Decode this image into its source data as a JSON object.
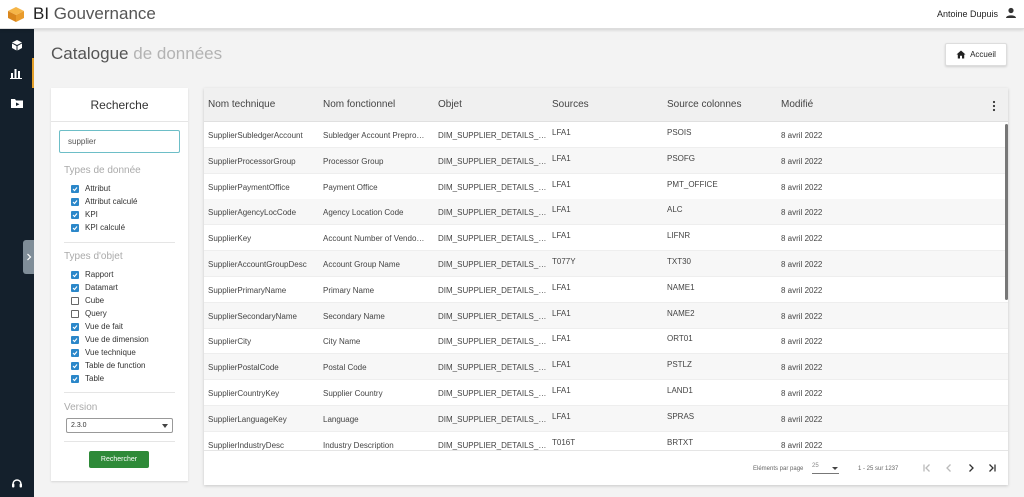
{
  "app": {
    "brand_prefix": "BI",
    "brand_name": "Gouvernance",
    "user_name": "Antoine Dupuis",
    "accent_color": "#e3a02b"
  },
  "nav": {
    "items": [
      "box-icon",
      "bar-chart-icon",
      "folder-video-icon"
    ],
    "bottom": "support-icon"
  },
  "page": {
    "title_main": "Catalogue",
    "title_light": "de données",
    "home_label": "Accueil"
  },
  "search": {
    "header": "Recherche",
    "query": "supplier",
    "data_types_title": "Types de donnée",
    "data_types": [
      {
        "label": "Attribut",
        "checked": true
      },
      {
        "label": "Attribut calculé",
        "checked": true
      },
      {
        "label": "KPI",
        "checked": true
      },
      {
        "label": "KPI calculé",
        "checked": true
      }
    ],
    "object_types_title": "Types d'objet",
    "object_types": [
      {
        "label": "Rapport",
        "checked": true
      },
      {
        "label": "Datamart",
        "checked": true
      },
      {
        "label": "Cube",
        "checked": false
      },
      {
        "label": "Query",
        "checked": false
      },
      {
        "label": "Vue de fait",
        "checked": true
      },
      {
        "label": "Vue de dimension",
        "checked": true
      },
      {
        "label": "Vue technique",
        "checked": true
      },
      {
        "label": "Table de function",
        "checked": true
      },
      {
        "label": "Table",
        "checked": true
      }
    ],
    "version_title": "Version",
    "version_value": "2.3.0",
    "button": "Rechercher",
    "button_color": "#2e8a38"
  },
  "table": {
    "columns": [
      "Nom technique",
      "Nom fonctionnel",
      "Objet",
      "Sources",
      "Source colonnes",
      "Modifié"
    ],
    "rows": [
      [
        "SupplierSubledgerAccount",
        "Subledger Account Prepro…",
        "DIM_SUPPLIER_DETAILS_…",
        "LFA1",
        "PSOIS",
        "8 avril 2022"
      ],
      [
        "SupplierProcessorGroup",
        "Processor Group",
        "DIM_SUPPLIER_DETAILS_…",
        "LFA1",
        "PSOFG",
        "8 avril 2022"
      ],
      [
        "SupplierPaymentOffice",
        "Payment Office",
        "DIM_SUPPLIER_DETAILS_…",
        "LFA1",
        "PMT_OFFICE",
        "8 avril 2022"
      ],
      [
        "SupplierAgencyLocCode",
        "Agency Location Code",
        "DIM_SUPPLIER_DETAILS_…",
        "LFA1",
        "ALC",
        "8 avril 2022"
      ],
      [
        "SupplierKey",
        "Account Number of Vendo…",
        "DIM_SUPPLIER_DETAILS_…",
        "LFA1",
        "LIFNR",
        "8 avril 2022"
      ],
      [
        "SupplierAccountGroupDesc",
        "Account Group Name",
        "DIM_SUPPLIER_DETAILS_…",
        "T077Y",
        "TXT30",
        "8 avril 2022"
      ],
      [
        "SupplierPrimaryName",
        "Primary Name",
        "DIM_SUPPLIER_DETAILS_…",
        "LFA1",
        "NAME1",
        "8 avril 2022"
      ],
      [
        "SupplierSecondaryName",
        "Secondary Name",
        "DIM_SUPPLIER_DETAILS_…",
        "LFA1",
        "NAME2",
        "8 avril 2022"
      ],
      [
        "SupplierCity",
        "City Name",
        "DIM_SUPPLIER_DETAILS_…",
        "LFA1",
        "ORT01",
        "8 avril 2022"
      ],
      [
        "SupplierPostalCode",
        "Postal Code",
        "DIM_SUPPLIER_DETAILS_…",
        "LFA1",
        "PSTLZ",
        "8 avril 2022"
      ],
      [
        "SupplierCountryKey",
        "Supplier Country",
        "DIM_SUPPLIER_DETAILS_…",
        "LFA1",
        "LAND1",
        "8 avril 2022"
      ],
      [
        "SupplierLanguageKey",
        "Language",
        "DIM_SUPPLIER_DETAILS_…",
        "LFA1",
        "SPRAS",
        "8 avril 2022"
      ],
      [
        "SupplierIndustryDesc",
        "Industry Description",
        "DIM_SUPPLIER_DETAILS_…",
        "T016T",
        "BRTXT",
        "8 avril 2022"
      ]
    ],
    "paginator": {
      "label": "Eléments par page",
      "page_size": "25",
      "range": "1 - 25 sur 1237"
    }
  }
}
